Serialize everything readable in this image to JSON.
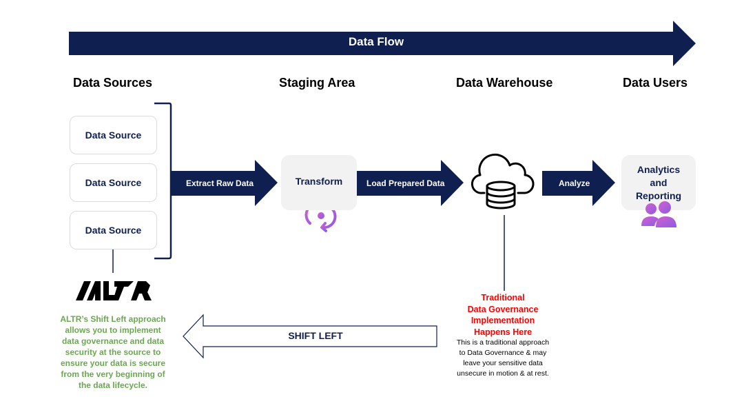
{
  "flow_banner": {
    "label": "Data Flow"
  },
  "stages": {
    "sources": "Data Sources",
    "staging": "Staging Area",
    "warehouse": "Data Warehouse",
    "users": "Data Users"
  },
  "data_sources": [
    "Data Source",
    "Data Source",
    "Data Source"
  ],
  "arrows": {
    "extract": "Extract Raw Data",
    "load": "Load Prepared Data",
    "analyze": "Analyze"
  },
  "transform_box": {
    "label": "Transform",
    "icon": "sync-icon"
  },
  "warehouse_icon": "cloud-database-icon",
  "analytics_box": {
    "lines": [
      "Analytics",
      "and",
      "Reporting"
    ],
    "icon": "users-icon"
  },
  "logo": {
    "name": "ALTR"
  },
  "altr_note": {
    "lines": [
      "ALTR’s Shift Left approach",
      "allows you to implement",
      "data governance and data",
      "security at the source to",
      "ensure your data is secure",
      "from the very beginning of",
      "the data lifecycle."
    ]
  },
  "shift_left": {
    "label": "SHIFT LEFT"
  },
  "traditional_note": {
    "heading_lines": [
      "Traditional",
      "Data Governance",
      "Implementation",
      "Happens Here"
    ],
    "body_lines": [
      "This is a traditional approach",
      "to Data Governance & may",
      "leave your sensitive data",
      "unsecure in motion & at rest."
    ]
  },
  "colors": {
    "navy": "#0f1f4f",
    "green": "#6aa84f",
    "red": "#ff0000",
    "box_grey": "#f2f2f2",
    "icon_gradient_start": "#c95bd0",
    "icon_gradient_end": "#8a5be0"
  }
}
